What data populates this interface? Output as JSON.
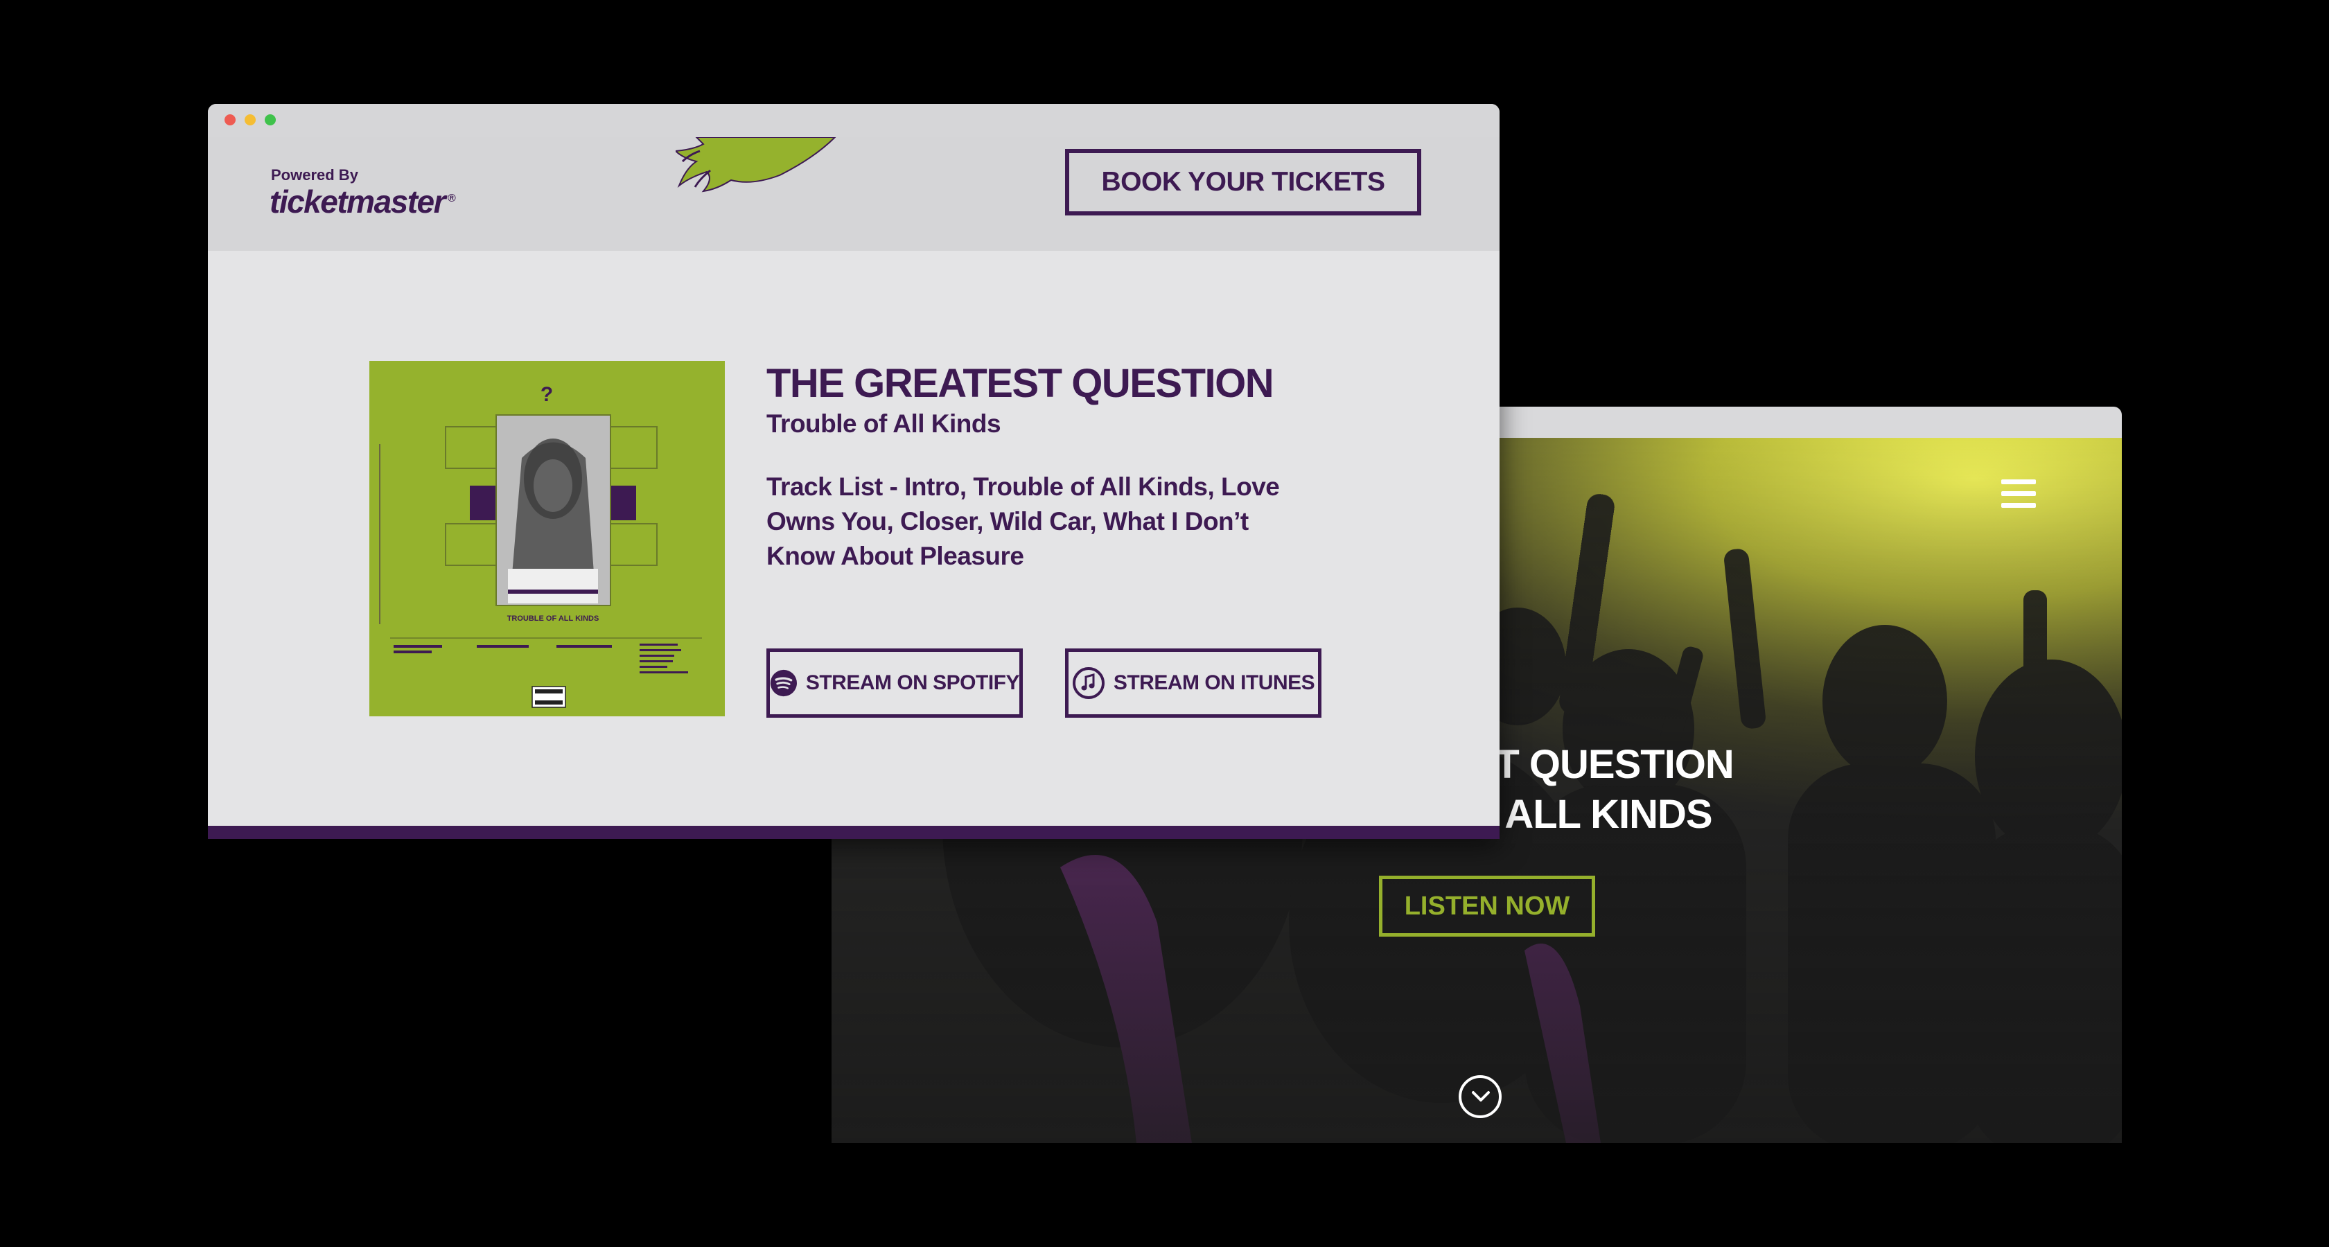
{
  "back_site": {
    "hero_line1": "THE GREATEST QUESTION",
    "hero_line2": "TROUBLE OF ALL KINDS",
    "listen_label": "LISTEN NOW",
    "menu_icon": "hamburger-icon",
    "scroll_icon": "chevron-down-circle-icon"
  },
  "front_site": {
    "powered_by": "Powered By",
    "logo_text": "ticketmaster",
    "logo_mark": "®",
    "book_label": "BOOK YOUR TICKETS",
    "album": {
      "title": "THE GREATEST QUESTION",
      "subtitle": "Trouble of All Kinds",
      "tracklist": "Track List - Intro, Trouble of All Kinds, Love Owns You, Closer, Wild Car, What I Don’t Know About Pleasure",
      "cover_question_mark": "?",
      "cover_caption": "TROUBLE OF ALL KINDS"
    },
    "spotify_label": "STREAM ON SPOTIFY",
    "itunes_label": "STREAM ON ITUNES"
  },
  "colors": {
    "brand_purple": "#3d1a52",
    "brand_green": "#95b22d",
    "page_bg": "#e4e4e6"
  }
}
